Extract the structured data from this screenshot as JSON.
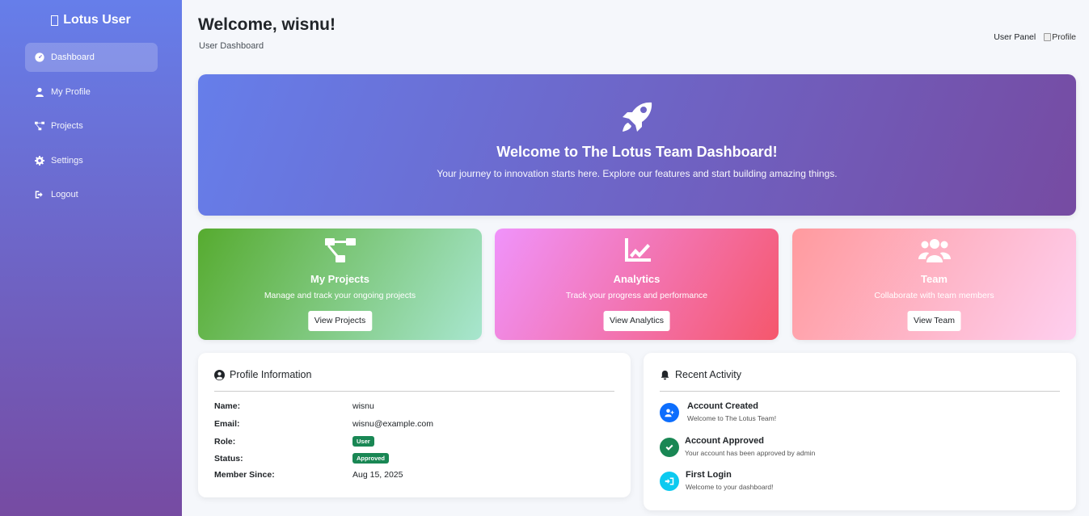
{
  "sidebar": {
    "brand": "Lotus User",
    "items": [
      {
        "label": "Dashboard",
        "icon": "dashboard-icon",
        "active": true
      },
      {
        "label": "My Profile",
        "icon": "user-icon",
        "active": false
      },
      {
        "label": "Projects",
        "icon": "project-diagram-icon",
        "active": false
      },
      {
        "label": "Settings",
        "icon": "gear-icon",
        "active": false
      },
      {
        "label": "Logout",
        "icon": "logout-icon",
        "active": false
      }
    ]
  },
  "header": {
    "title": "Welcome, wisnu!",
    "subtitle": "User Dashboard",
    "panel_label": "User Panel",
    "profile_alt": "Profile"
  },
  "hero": {
    "icon": "rocket-icon",
    "title": "Welcome to The Lotus Team Dashboard!",
    "text": "Your journey to innovation starts here. Explore our features and start building amazing things."
  },
  "cards": [
    {
      "title": "My Projects",
      "text": "Manage and track your ongoing projects",
      "button": "View Projects",
      "icon": "project-diagram-icon"
    },
    {
      "title": "Analytics",
      "text": "Track your progress and performance",
      "button": "View Analytics",
      "icon": "chart-line-icon"
    },
    {
      "title": "Team",
      "text": "Collaborate with team members",
      "button": "View Team",
      "icon": "users-icon"
    }
  ],
  "profile": {
    "heading": "Profile Information",
    "rows": [
      {
        "label": "Name:",
        "value": "wisnu"
      },
      {
        "label": "Email:",
        "value": "wisnu@example.com"
      },
      {
        "label": "Role:",
        "value": "User"
      },
      {
        "label": "Status:",
        "value": "Approved"
      },
      {
        "label": "Member Since:",
        "value": "Aug 15, 2025"
      }
    ]
  },
  "activity": {
    "heading": "Recent Activity",
    "items": [
      {
        "title": "Account Created",
        "desc": "Welcome to The Lotus Team!",
        "color": "#0d6efd",
        "icon": "user-plus-icon"
      },
      {
        "title": "Account Approved",
        "desc": "Your account has been approved by admin",
        "color": "#198754",
        "icon": "check-icon"
      },
      {
        "title": "First Login",
        "desc": "Welcome to your dashboard!",
        "color": "#0dcaf0",
        "icon": "sign-in-icon"
      }
    ]
  },
  "colors": {
    "primary_gradient_start": "#667eea",
    "primary_gradient_end": "#764ba2",
    "badge_green": "#198754"
  }
}
